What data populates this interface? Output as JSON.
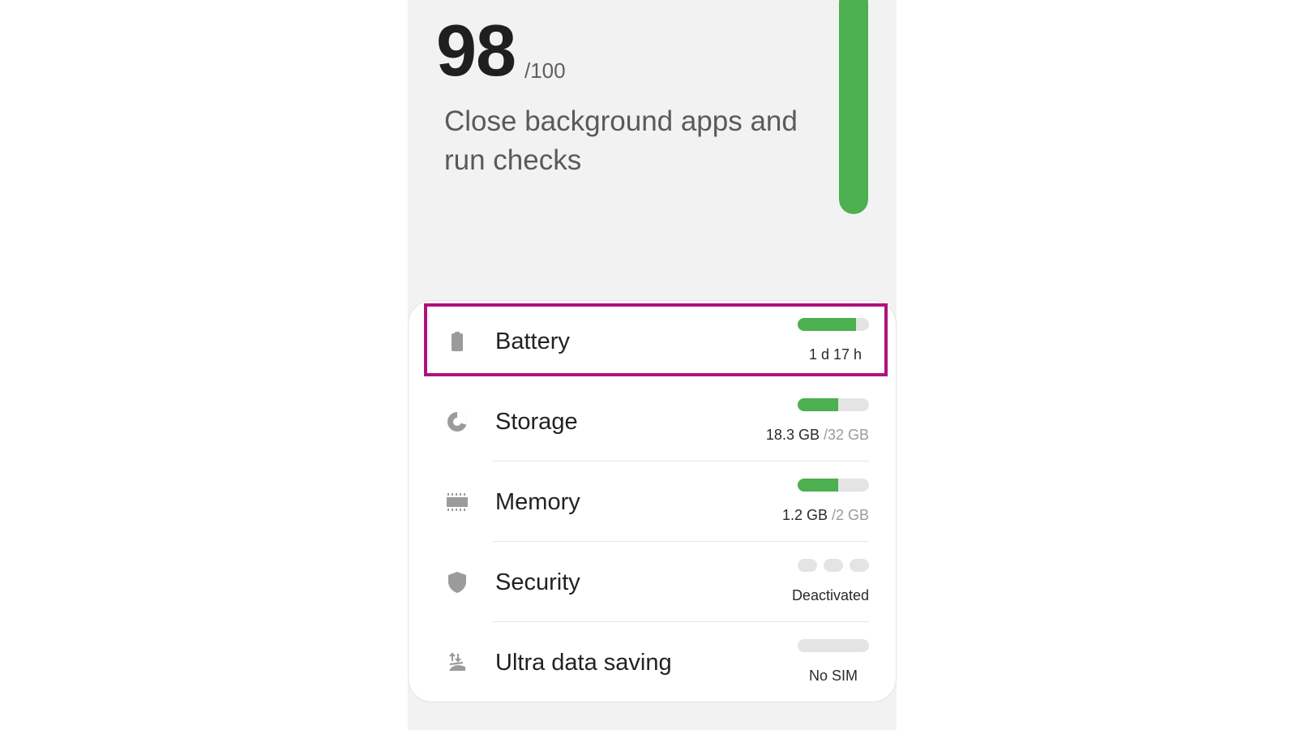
{
  "score": {
    "value": "98",
    "max": "/100",
    "message": "Close background apps and run checks",
    "level": 0.98,
    "color": "#4caf50"
  },
  "items": [
    {
      "label": "Battery",
      "icon": "battery-icon",
      "value": "1 d 17 h",
      "sub": "",
      "level": 0.82,
      "selected": true
    },
    {
      "label": "Storage",
      "icon": "pie-chart-icon",
      "value": "18.3 GB",
      "sub": " /32 GB",
      "level": 0.57
    },
    {
      "label": "Memory",
      "icon": "memory-chip-icon",
      "value": "1.2 GB",
      "sub": " /2 GB",
      "level": 0.57
    },
    {
      "label": "Security",
      "icon": "shield-icon",
      "value": "Deactivated",
      "sub": "",
      "segments_active": 0
    },
    {
      "label": "Ultra data saving",
      "icon": "data-saving-icon",
      "value": "No SIM",
      "sub": "",
      "level": 0
    }
  ],
  "colors": {
    "accent": "#4caf50",
    "track": "#e4e4e4",
    "highlight": "#b0117f",
    "icon": "#9b9b9b"
  }
}
